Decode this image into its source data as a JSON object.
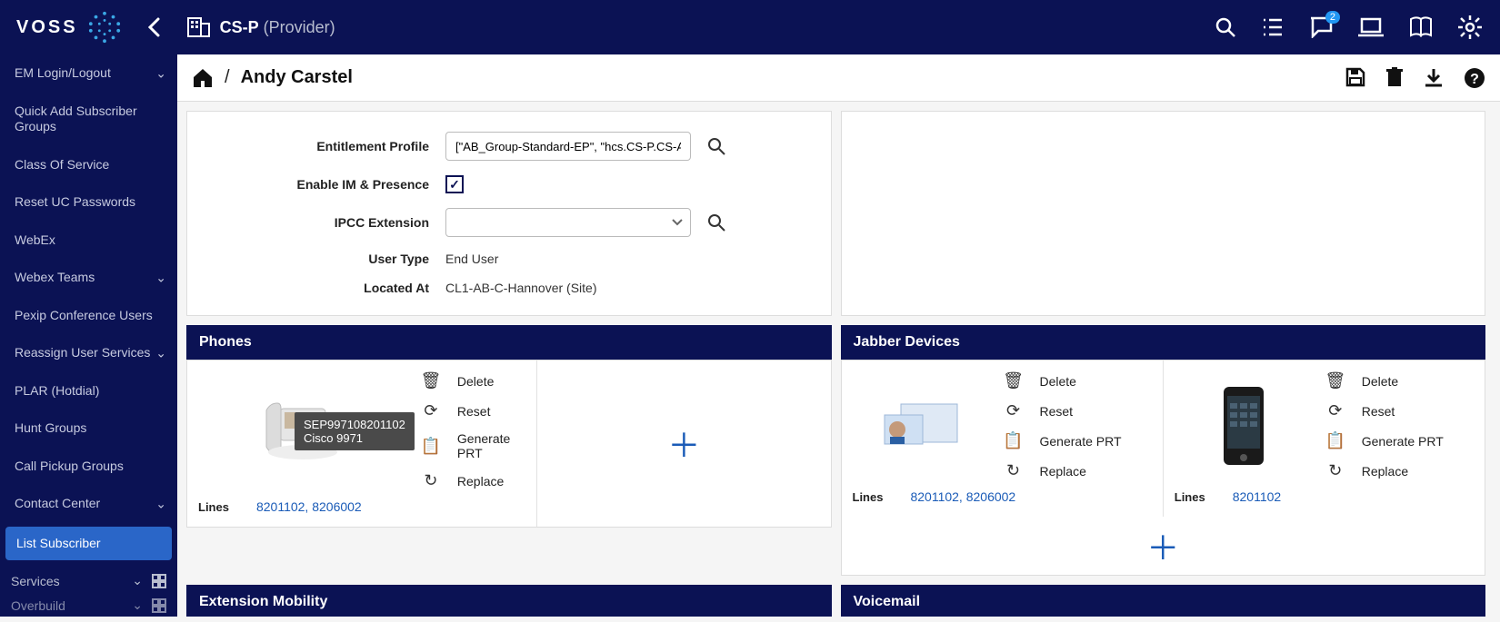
{
  "brand": {
    "name": "VOSS"
  },
  "org": {
    "name": "CS-P",
    "suffix": "(Provider)"
  },
  "topbar": {
    "notif_count": "2"
  },
  "breadcrumb": {
    "title": "Andy Carstel"
  },
  "sidebar": {
    "items": [
      "EM Login/Logout",
      "Quick Add Subscriber Groups",
      "Class Of Service",
      "Reset UC Passwords",
      "WebEx",
      "Webex Teams",
      "Pexip Conference Users",
      "Reassign User Services",
      "PLAR (Hotdial)",
      "Hunt Groups",
      "Call Pickup Groups",
      "Contact Center",
      "List Subscriber"
    ],
    "bottom1": "Services",
    "bottom2": "Overbuild"
  },
  "form": {
    "entitlement_label": "Entitlement Profile",
    "entitlement_value": "[\"AB_Group-Standard-EP\", \"hcs.CS-P.CS-AB.AB_G",
    "im_label": "Enable IM & Presence",
    "ipcc_label": "IPCC Extension",
    "usertype_label": "User Type",
    "usertype_value": "End User",
    "located_label": "Located At",
    "located_value": "CL1-AB-C-Hannover (Site)"
  },
  "sections": {
    "phones": "Phones",
    "jabber": "Jabber Devices",
    "em": "Extension Mobility",
    "vm": "Voicemail"
  },
  "actions": {
    "delete": "Delete",
    "reset": "Reset",
    "prt": "Generate PRT",
    "replace": "Replace"
  },
  "phones": {
    "tooltip_line1": "SEP997108201102",
    "tooltip_line2": "Cisco 9971",
    "lines_label": "Lines",
    "lines_value": "8201102, 8206002"
  },
  "jabber": {
    "lines_label": "Lines",
    "d1_lines": "8201102, 8206002",
    "d2_lines": "8201102"
  }
}
